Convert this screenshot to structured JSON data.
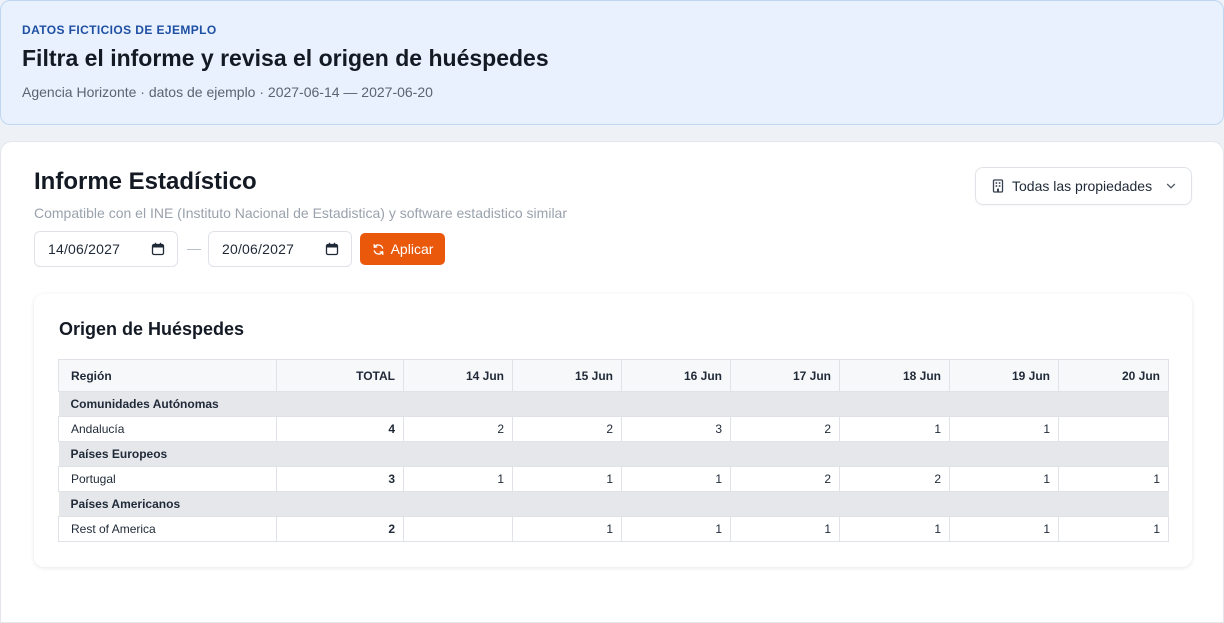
{
  "banner": {
    "eyebrow": "DATOS FICTICIOS DE EJEMPLO",
    "title": "Filtra el informe y revisa el origen de huéspedes",
    "subtitle": "Agencia Horizonte · datos de ejemplo · 2027-06-14 — 2027-06-20"
  },
  "report": {
    "title": "Informe Estadístico",
    "description": "Compatible con el INE (Instituto Nacional de Estadistica) y software estadistico similar",
    "property_select": "Todas las propiedades",
    "date_from": "14/06/2027",
    "date_to": "20/06/2027",
    "date_separator": "—",
    "apply_label": "Aplicar"
  },
  "origin": {
    "title": "Origen de Huéspedes",
    "columns": [
      "Región",
      "TOTAL",
      "14 Jun",
      "15 Jun",
      "16 Jun",
      "17 Jun",
      "18 Jun",
      "19 Jun",
      "20 Jun"
    ],
    "groups": [
      {
        "name": "Comunidades Autónomas",
        "rows": [
          {
            "region": "Andalucía",
            "total": "4",
            "days": [
              "2",
              "2",
              "3",
              "2",
              "1",
              "1",
              ""
            ]
          }
        ]
      },
      {
        "name": "Países Europeos",
        "rows": [
          {
            "region": "Portugal",
            "total": "3",
            "days": [
              "1",
              "1",
              "1",
              "2",
              "2",
              "1",
              "1"
            ]
          }
        ]
      },
      {
        "name": "Países Americanos",
        "rows": [
          {
            "region": "Rest of America",
            "total": "2",
            "days": [
              "",
              "1",
              "1",
              "1",
              "1",
              "1",
              "1"
            ]
          }
        ]
      }
    ]
  },
  "colors": {
    "accent": "#ea580c",
    "banner_bg": "#e8f1fd",
    "eyebrow": "#1e4fa3"
  },
  "icons": {
    "property": "building-icon",
    "dropdown": "chevron-down-icon",
    "calendar": "calendar-icon",
    "apply": "refresh-icon"
  }
}
